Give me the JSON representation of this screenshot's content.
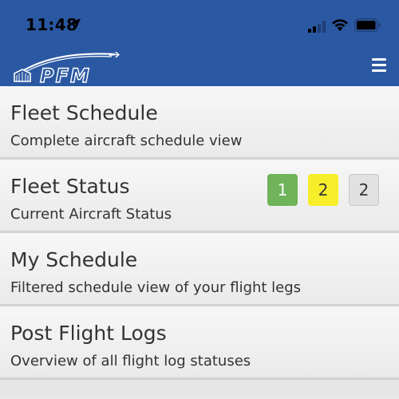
{
  "status_bar": {
    "time": "11:48",
    "icons": [
      "location-arrow-icon",
      "cell-signal-icon",
      "wifi-icon",
      "battery-icon"
    ]
  },
  "nav": {
    "logo_text": "PFM",
    "menu_icon": "hamburger-menu-icon"
  },
  "colors": {
    "header": "#2b58a2",
    "badge_green": "#6fb35a",
    "badge_yellow": "#f7ee2a",
    "badge_gray": "#e1e1e1"
  },
  "menu_items": [
    {
      "title": "Fleet Schedule",
      "subtitle": "Complete aircraft schedule view"
    },
    {
      "title": "Fleet Status",
      "subtitle": "Current Aircraft Status"
    },
    {
      "title": "My Schedule",
      "subtitle": "Filtered schedule view of your flight legs"
    },
    {
      "title": "Post Flight Logs",
      "subtitle": "Overview of all flight log statuses"
    }
  ],
  "fleet_status_badges": [
    {
      "value": "1",
      "color": "green"
    },
    {
      "value": "2",
      "color": "yellow"
    },
    {
      "value": "2",
      "color": "gray"
    }
  ]
}
